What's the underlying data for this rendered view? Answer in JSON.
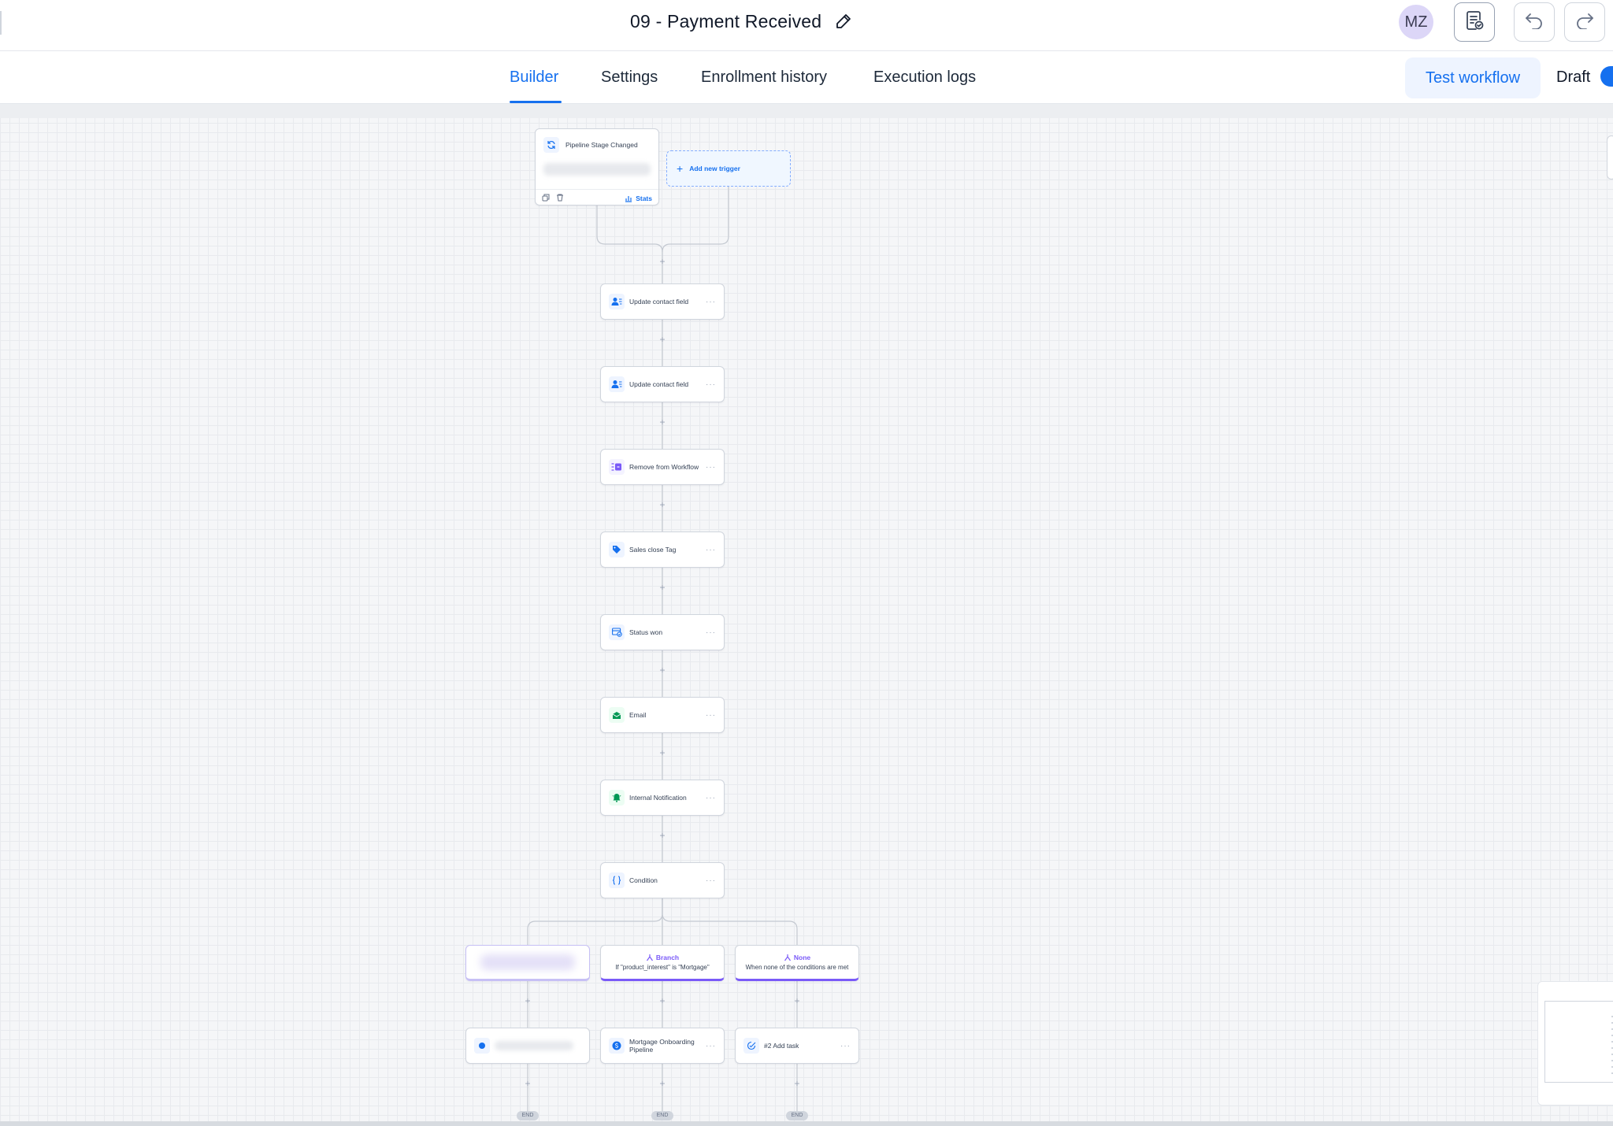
{
  "header": {
    "title": "09 - Payment Received",
    "avatar_initials": "MZ"
  },
  "tabs": {
    "builder": "Builder",
    "settings": "Settings",
    "enrollment": "Enrollment history",
    "execution": "Execution logs",
    "active": "Builder"
  },
  "toolbar": {
    "test_label": "Test workflow",
    "draft_label": "Draft"
  },
  "workflow": {
    "trigger": {
      "label": "Pipeline Stage Changed",
      "stats_label": "Stats"
    },
    "add_trigger_label": "Add new trigger",
    "actions": [
      {
        "label": "Update contact field",
        "icon": "contact-icon"
      },
      {
        "label": "Update contact field",
        "icon": "contact-icon"
      },
      {
        "label": "Remove from Workflow",
        "icon": "remove-workflow-icon"
      },
      {
        "label": "Sales close Tag",
        "icon": "tag-icon"
      },
      {
        "label": "Status won",
        "icon": "status-icon"
      },
      {
        "label": "Email",
        "icon": "email-icon"
      },
      {
        "label": "Internal Notification",
        "icon": "bell-icon"
      },
      {
        "label": "Condition",
        "icon": "braces-icon"
      }
    ],
    "branches": [
      {
        "title": "Branch",
        "desc": "If \"product_interest\" is \"Mortgage\""
      },
      {
        "title": "None",
        "desc": "When none of the conditions are met"
      }
    ],
    "branch_actions": [
      {
        "label": "Mortgage Onboarding Pipeline",
        "icon": "dollar-icon"
      },
      {
        "label": "#2 Add task",
        "icon": "task-icon"
      }
    ],
    "end_label": "END",
    "more_label": "···",
    "plus_label": "+"
  },
  "colors": {
    "accent": "#1570ef",
    "branch": "#7a5af8",
    "email_green": "#12b76a",
    "purple": "#7a5af8"
  }
}
